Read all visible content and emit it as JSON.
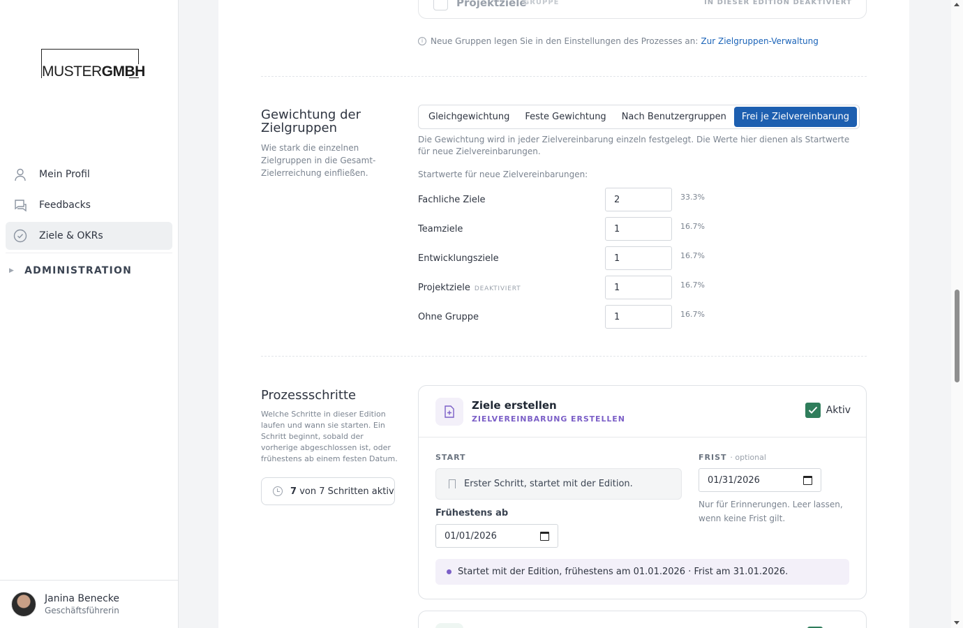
{
  "brand": {
    "logo_light": "MUSTER",
    "logo_bold": "GMBH"
  },
  "sidebar": {
    "items": [
      {
        "label": "Mein Profil",
        "icon": "user-icon"
      },
      {
        "label": "Feedbacks",
        "icon": "chat-icon"
      },
      {
        "label": "Ziele & OKRs",
        "icon": "check-circle-icon",
        "active": true
      }
    ],
    "admin_label": "ADMINISTRATION"
  },
  "user": {
    "name": "Janina Benecke",
    "role": "Geschäftsführerin"
  },
  "top_group": {
    "name": "Projektziele",
    "tag": "GRUPPE",
    "status": "IN DIESER EDITION DEAKTIVIERT"
  },
  "groups_hint": {
    "text": "Neue Gruppen legen Sie in den Einstellungen des Prozesses an:",
    "link": "Zur Zielgruppen-Verwaltung"
  },
  "weighting": {
    "title": "Gewichtung der Zielgruppen",
    "description": "Wie stark die einzelnen Zielgruppen in die Gesamt-Zielerreichung einfließen.",
    "modes": [
      "Gleichgewichtung",
      "Feste Gewichtung",
      "Nach Benutzergruppen",
      "Frei je Zielvereinbarung"
    ],
    "active_mode": "Frei je Zielvereinbarung",
    "mode_description": "Die Gewichtung wird in jeder Zielvereinbarung einzeln festgelegt. Die Werte hier dienen als Startwerte für neue Zielvereinbarungen.",
    "start_label": "Startwerte für neue Zielvereinbarungen:",
    "rows": [
      {
        "label": "Fachliche Ziele",
        "tag": "",
        "value": "2",
        "percent": "33.3%"
      },
      {
        "label": "Teamziele",
        "tag": "",
        "value": "1",
        "percent": "16.7%"
      },
      {
        "label": "Entwicklungsziele",
        "tag": "",
        "value": "1",
        "percent": "16.7%"
      },
      {
        "label": "Projektziele",
        "tag": "DEAKTIVIERT",
        "value": "1",
        "percent": "16.7%"
      },
      {
        "label": "Ohne Gruppe",
        "tag": "",
        "value": "1",
        "percent": "16.7%"
      }
    ]
  },
  "process": {
    "title": "Prozessschritte",
    "description": "Welche Schritte in dieser Edition laufen und wann sie starten. Ein Schritt beginnt, sobald der vorherige abgeschlossen ist, oder frühestens ab einem festen Datum.",
    "counter_active": "7",
    "counter_rest": "von 7 Schritten aktiv",
    "step": {
      "title": "Ziele erstellen",
      "subtitle": "ZIELVEREINBARUNG ERSTELLEN",
      "active_label": "Aktiv",
      "active": true,
      "start_label": "START",
      "start_text": "Erster Schritt, startet mit der Edition.",
      "deadline_label": "FRIST",
      "deadline_optional": "· optional",
      "deadline_value": "01/31/2026",
      "deadline_hint": "Nur für Erinnerungen. Leer lassen, wenn keine Frist gilt.",
      "earliest_label": "Frühestens ab",
      "earliest_value": "01/01/2026",
      "summary": "Startet mit der Edition, frühestens am 01.01.2026 · Frist am 31.01.2026."
    }
  },
  "colors": {
    "accent": "#1d5fb0",
    "step_purple": "#7b5fc7",
    "check_green": "#2f7d5b",
    "link": "#1a63b8"
  }
}
